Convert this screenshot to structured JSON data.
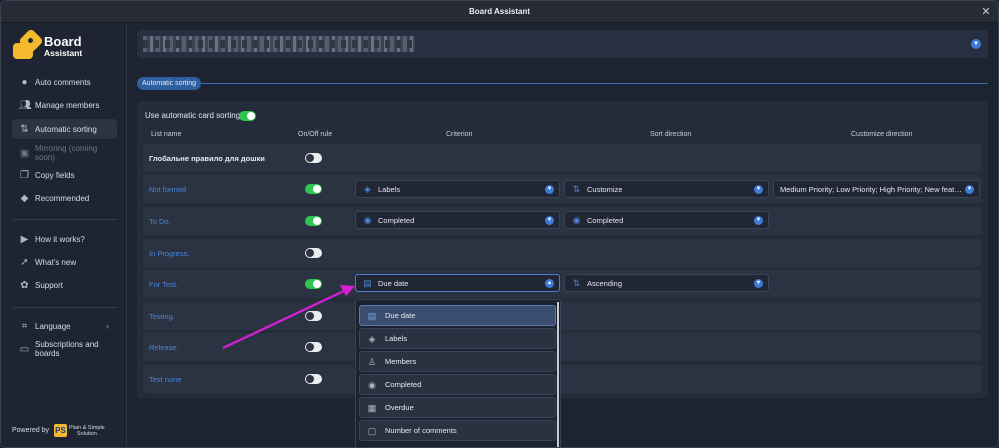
{
  "window": {
    "title": "Board Assistant"
  },
  "logo": {
    "line1": "Board",
    "line2": "Assistant"
  },
  "sidebar": {
    "items": [
      {
        "label": "Auto comments",
        "icon": "chat-icon"
      },
      {
        "label": "Manage members",
        "icon": "users-icon"
      },
      {
        "label": "Automatic sorting",
        "icon": "sort-icon",
        "active": true
      },
      {
        "label": "Mirroring (coming soon)",
        "icon": "mirror-icon",
        "disabled": true
      },
      {
        "label": "Copy fields",
        "icon": "copy-icon"
      },
      {
        "label": "Recommended",
        "icon": "diamond-icon"
      },
      {
        "label": "How it works?",
        "icon": "video-icon"
      },
      {
        "label": "What's new",
        "icon": "rocket-icon"
      },
      {
        "label": "Support",
        "icon": "support-icon"
      },
      {
        "label": "Language",
        "icon": "language-icon"
      },
      {
        "label": "Subscriptions and boards",
        "icon": "card-icon"
      }
    ],
    "powered_by": "Powered by",
    "brand_letters": "PS",
    "brand_line1": "Plain & Simple",
    "brand_line2": "Solution"
  },
  "section": {
    "tab": "Automatic sorting"
  },
  "settings": {
    "use_auto_label": "Use automatic card sorting",
    "use_auto_on": true
  },
  "table": {
    "headers": [
      "List name",
      "On/Off rule",
      "Criterion",
      "Sort direction",
      "Customize direction"
    ],
    "rows": [
      {
        "name": "Глобальне правило для дошки",
        "on": false
      },
      {
        "name": "Not formed",
        "on": true,
        "criterion": "Labels",
        "direction": "Customize",
        "customize": "Medium Priority; Low Priority; High Priority; New featur..."
      },
      {
        "name": "To Do.",
        "on": true,
        "criterion": "Completed",
        "direction": "Completed"
      },
      {
        "name": "In Progress.",
        "on": false
      },
      {
        "name": "For Test.",
        "on": true,
        "criterion": "Due date",
        "direction": "Ascending"
      },
      {
        "name": "Testing.",
        "on": false
      },
      {
        "name": "Release.",
        "on": false
      },
      {
        "name": "Test none",
        "on": false
      }
    ]
  },
  "dropdown": {
    "options": [
      {
        "label": "Due date",
        "icon": "calendar-clock-icon",
        "selected": true
      },
      {
        "label": "Labels",
        "icon": "tag-icon"
      },
      {
        "label": "Members",
        "icon": "person-icon"
      },
      {
        "label": "Completed",
        "icon": "radio-icon"
      },
      {
        "label": "Overdue",
        "icon": "calendar-alert-icon"
      },
      {
        "label": "Number of comments",
        "icon": "comment-icon"
      }
    ]
  },
  "colors": {
    "accent": "#3d7bd9",
    "toggle_on": "#2ec44f",
    "annotation_arrow": "#d81fd8",
    "logo": "#f5b92d"
  }
}
